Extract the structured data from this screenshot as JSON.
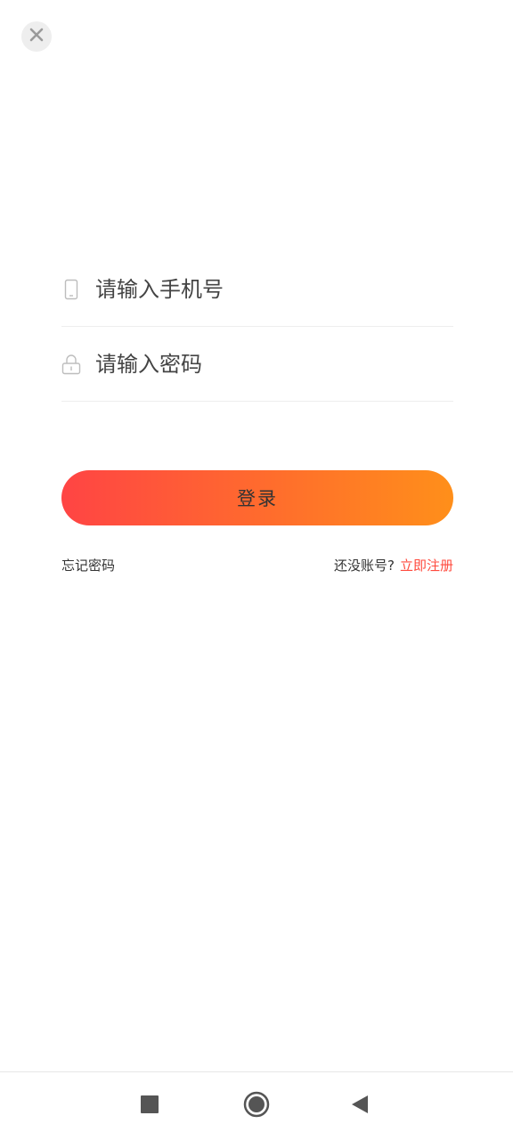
{
  "header": {
    "close_icon": "close-icon"
  },
  "form": {
    "phone": {
      "placeholder": "请输入手机号",
      "value": "",
      "icon": "phone-icon"
    },
    "password": {
      "placeholder": "请输入密码",
      "value": "",
      "icon": "lock-icon"
    },
    "login_label": "登录",
    "forgot_label": "忘记密码",
    "no_account_label": "还没账号?",
    "register_label": "立即注册"
  },
  "colors": {
    "gradient_start": "#ff4444",
    "gradient_end": "#ff8f1a",
    "register_link": "#ff4a3d"
  },
  "nav": {
    "recent_icon": "square-icon",
    "home_icon": "circle-icon",
    "back_icon": "triangle-back-icon"
  }
}
